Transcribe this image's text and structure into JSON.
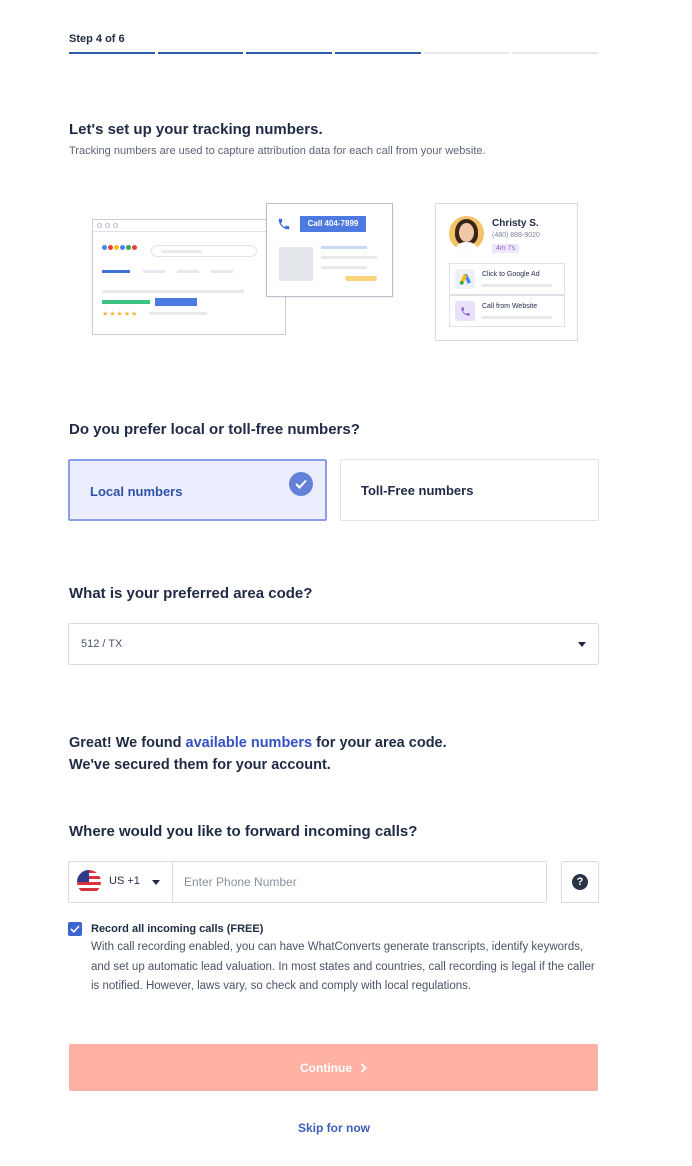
{
  "progress": {
    "label": "Step 4 of 6",
    "current_step": 4,
    "total_steps": 6
  },
  "intro": {
    "title": "Let's set up your tracking numbers.",
    "subtitle": "Tracking numbers are used to capture attribution data for each call from your website."
  },
  "illustration": {
    "call_button_label": "Call 404-7899",
    "contact_name": "Christy S.",
    "contact_phone": "(480) 888-9020",
    "call_duration": "4m 7s",
    "source_1_label": "Click to Google Ad",
    "source_2_label": "Call from Website",
    "rating_stars": "★★★★★"
  },
  "number_type": {
    "question": "Do you prefer local or toll-free numbers?",
    "options": [
      {
        "label": "Local numbers",
        "selected": true
      },
      {
        "label": "Toll-Free numbers",
        "selected": false
      }
    ]
  },
  "area_code": {
    "question": "What is your preferred area code?",
    "selected_value": "512 / TX"
  },
  "found_message": {
    "part1": "Great! We found ",
    "link_text": "available numbers",
    "part2": " for your area code.",
    "line2": "We've secured them for your account."
  },
  "forwarding": {
    "question": "Where would you like to forward incoming calls?",
    "country_code": "US +1",
    "phone_placeholder": "Enter Phone Number",
    "phone_value": "",
    "help_symbol": "?"
  },
  "recording": {
    "checked": true,
    "label": "Record all incoming calls (FREE)",
    "description": "With call recording enabled, you can have WhatConverts generate transcripts, identify keywords, and set up automatic lead valuation. In most states and countries, call recording is legal if the caller is notified. However, laws vary, so check and comply with local regulations."
  },
  "actions": {
    "continue_label": "Continue",
    "skip_label": "Skip for now"
  },
  "colors": {
    "accent_blue": "#2f5ea8",
    "selected_bg": "#eceefd",
    "continue_disabled": "#ffb2a4",
    "link": "#3452c4"
  }
}
